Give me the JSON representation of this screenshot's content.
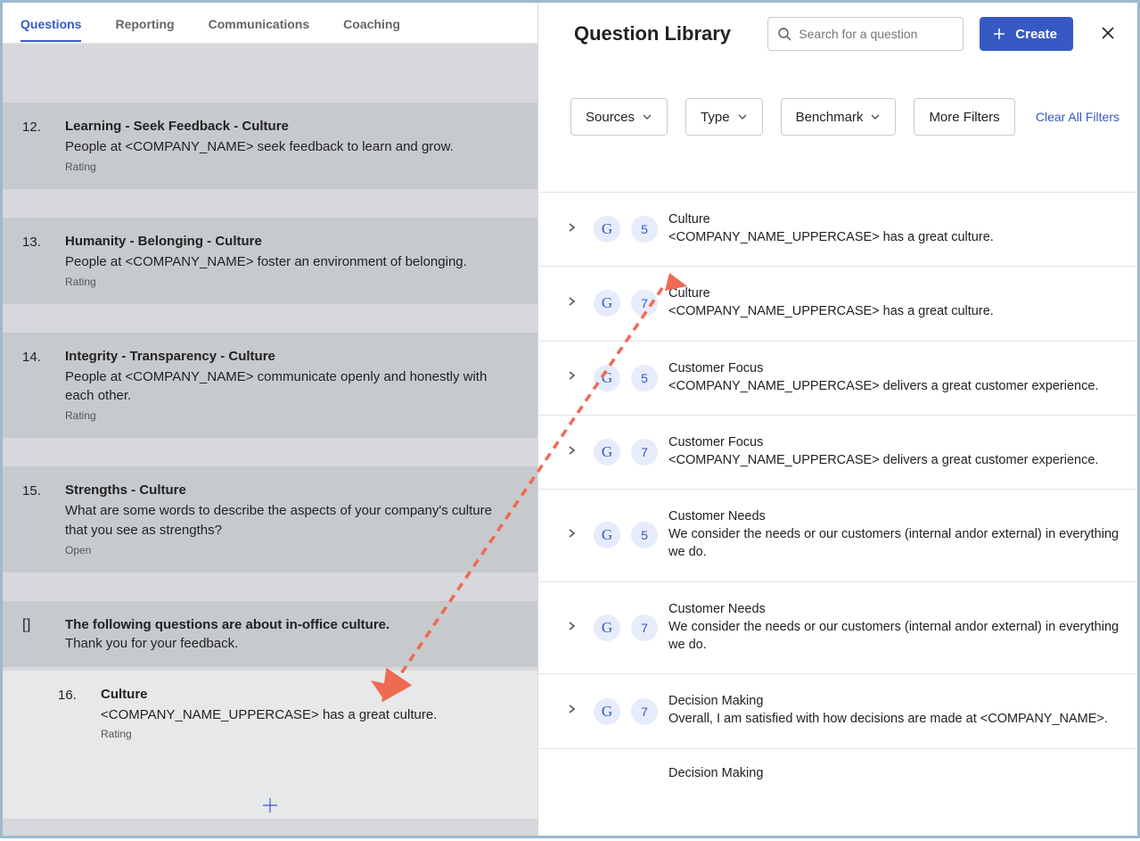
{
  "tabs": {
    "questions": "Questions",
    "reporting": "Reporting",
    "communications": "Communications",
    "coaching": "Coaching"
  },
  "library": {
    "title": "Question Library",
    "search_placeholder": "Search for a question",
    "create_label": "Create",
    "filters": {
      "sources": "Sources",
      "type": "Type",
      "benchmark": "Benchmark",
      "more": "More Filters",
      "clear": "Clear All Filters"
    }
  },
  "questions": [
    {
      "num": "12.",
      "title": "Learning - Seek Feedback - Culture",
      "desc": "People at <COMPANY_NAME> seek feedback to learn and grow.",
      "type": "Rating"
    },
    {
      "num": "13.",
      "title": "Humanity - Belonging - Culture",
      "desc": "People at <COMPANY_NAME> foster an environment of belonging.",
      "type": "Rating"
    },
    {
      "num": "14.",
      "title": "Integrity - Transparency - Culture",
      "desc": "People at <COMPANY_NAME> communicate openly and honestly with each other.",
      "type": "Rating"
    },
    {
      "num": "15.",
      "title": "Strengths - Culture",
      "desc": "What are some words to describe the aspects of your company's culture that you see as strengths?",
      "type": "Open"
    }
  ],
  "section": {
    "marker": "[  ]",
    "title": "The following questions are about in-office culture.",
    "desc": "Thank you for your feedback."
  },
  "q16": {
    "num": "16.",
    "title": "Culture",
    "desc": "<COMPANY_NAME_UPPERCASE> has a great culture.",
    "type": "Rating"
  },
  "lib_items": [
    {
      "badge": "5",
      "cat": "Culture",
      "text": "<COMPANY_NAME_UPPERCASE> has a great culture."
    },
    {
      "badge": "7",
      "cat": "Culture",
      "text": "<COMPANY_NAME_UPPERCASE> has a great culture."
    },
    {
      "badge": "5",
      "cat": "Customer Focus",
      "text": "<COMPANY_NAME_UPPERCASE> delivers a great customer experience."
    },
    {
      "badge": "7",
      "cat": "Customer Focus",
      "text": "<COMPANY_NAME_UPPERCASE> delivers a great customer experience."
    },
    {
      "badge": "5",
      "cat": "Customer Needs",
      "text": "We consider the needs or our customers (internal andor external) in everything we do."
    },
    {
      "badge": "7",
      "cat": "Customer Needs",
      "text": "We consider the needs or our customers (internal andor external) in everything we do."
    },
    {
      "badge": "7",
      "cat": "Decision Making",
      "text": "Overall, I am satisfied with how decisions are made at <COMPANY_NAME>."
    }
  ],
  "lib_partial": {
    "cat": "Decision Making"
  },
  "g_glyph": "G"
}
